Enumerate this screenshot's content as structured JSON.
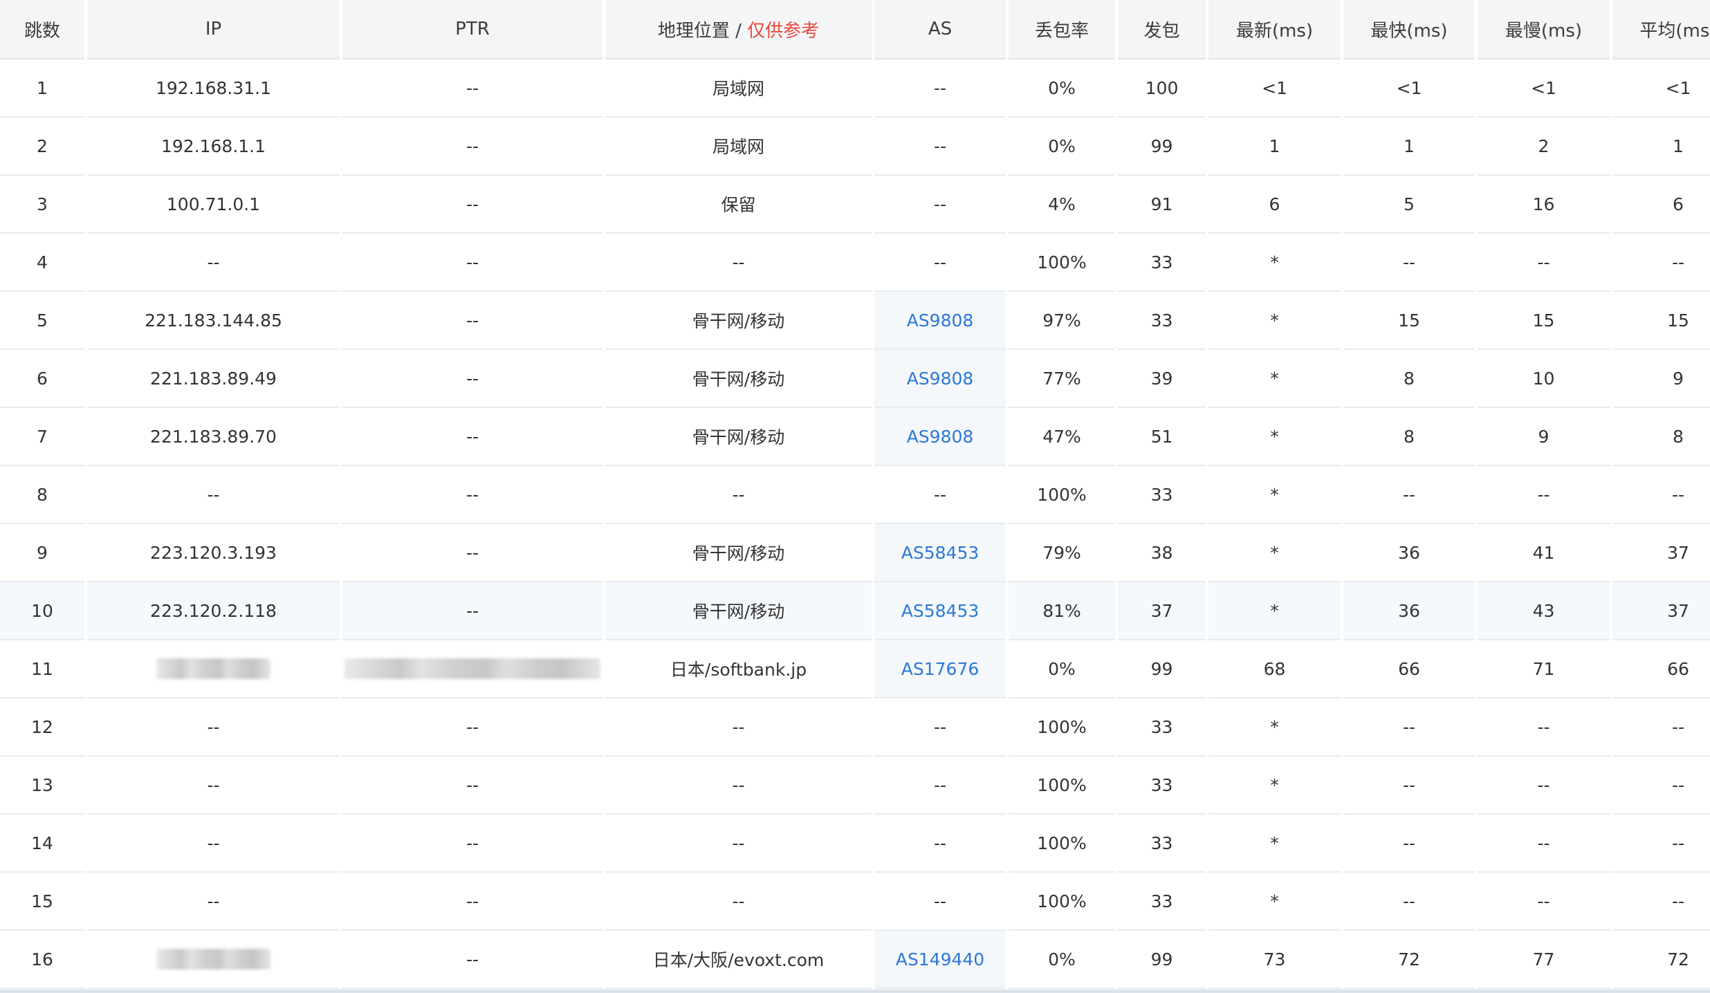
{
  "headers": {
    "hop": "跳数",
    "ip": "IP",
    "ptr": "PTR",
    "geo": "地理位置 / ",
    "geo_note": "仅供参考",
    "as": "AS",
    "loss": "丢包率",
    "sent": "发包",
    "last": "最新(ms)",
    "best": "最快(ms)",
    "worst": "最慢(ms)",
    "avg": "平均(ms)"
  },
  "rows": [
    {
      "hop": "1",
      "ip": "192.168.31.1",
      "ptr": "--",
      "geo": "局域网",
      "as": "--",
      "loss": "0%",
      "sent": "100",
      "last": "<1",
      "best": "<1",
      "worst": "<1",
      "avg": "<1"
    },
    {
      "hop": "2",
      "ip": "192.168.1.1",
      "ptr": "--",
      "geo": "局域网",
      "as": "--",
      "loss": "0%",
      "sent": "99",
      "last": "1",
      "best": "1",
      "worst": "2",
      "avg": "1"
    },
    {
      "hop": "3",
      "ip": "100.71.0.1",
      "ptr": "--",
      "geo": "保留",
      "as": "--",
      "loss": "4%",
      "sent": "91",
      "last": "6",
      "best": "5",
      "worst": "16",
      "avg": "6"
    },
    {
      "hop": "4",
      "ip": "--",
      "ptr": "--",
      "geo": "--",
      "as": "--",
      "loss": "100%",
      "sent": "33",
      "last": "*",
      "best": "--",
      "worst": "--",
      "avg": "--"
    },
    {
      "hop": "5",
      "ip": "221.183.144.85",
      "ptr": "--",
      "geo": "骨干网/移动",
      "as": "AS9808",
      "loss": "97%",
      "sent": "33",
      "last": "*",
      "best": "15",
      "worst": "15",
      "avg": "15"
    },
    {
      "hop": "6",
      "ip": "221.183.89.49",
      "ptr": "--",
      "geo": "骨干网/移动",
      "as": "AS9808",
      "loss": "77%",
      "sent": "39",
      "last": "*",
      "best": "8",
      "worst": "10",
      "avg": "9"
    },
    {
      "hop": "7",
      "ip": "221.183.89.70",
      "ptr": "--",
      "geo": "骨干网/移动",
      "as": "AS9808",
      "loss": "47%",
      "sent": "51",
      "last": "*",
      "best": "8",
      "worst": "9",
      "avg": "8"
    },
    {
      "hop": "8",
      "ip": "--",
      "ptr": "--",
      "geo": "--",
      "as": "--",
      "loss": "100%",
      "sent": "33",
      "last": "*",
      "best": "--",
      "worst": "--",
      "avg": "--"
    },
    {
      "hop": "9",
      "ip": "223.120.3.193",
      "ptr": "--",
      "geo": "骨干网/移动",
      "as": "AS58453",
      "loss": "79%",
      "sent": "38",
      "last": "*",
      "best": "36",
      "worst": "41",
      "avg": "37"
    },
    {
      "hop": "10",
      "ip": "223.120.2.118",
      "ptr": "--",
      "geo": "骨干网/移动",
      "as": "AS58453",
      "loss": "81%",
      "sent": "37",
      "last": "*",
      "best": "36",
      "worst": "43",
      "avg": "37"
    },
    {
      "hop": "11",
      "ip": "",
      "ptr": "",
      "geo": "日本/softbank.jp",
      "as": "AS17676",
      "loss": "0%",
      "sent": "99",
      "last": "68",
      "best": "66",
      "worst": "71",
      "avg": "66"
    },
    {
      "hop": "12",
      "ip": "--",
      "ptr": "--",
      "geo": "--",
      "as": "--",
      "loss": "100%",
      "sent": "33",
      "last": "*",
      "best": "--",
      "worst": "--",
      "avg": "--"
    },
    {
      "hop": "13",
      "ip": "--",
      "ptr": "--",
      "geo": "--",
      "as": "--",
      "loss": "100%",
      "sent": "33",
      "last": "*",
      "best": "--",
      "worst": "--",
      "avg": "--"
    },
    {
      "hop": "14",
      "ip": "--",
      "ptr": "--",
      "geo": "--",
      "as": "--",
      "loss": "100%",
      "sent": "33",
      "last": "*",
      "best": "--",
      "worst": "--",
      "avg": "--"
    },
    {
      "hop": "15",
      "ip": "--",
      "ptr": "--",
      "geo": "--",
      "as": "--",
      "loss": "100%",
      "sent": "33",
      "last": "*",
      "best": "--",
      "worst": "--",
      "avg": "--"
    },
    {
      "hop": "16",
      "ip": "",
      "ptr": "--",
      "geo": "日本/大阪/evoxt.com",
      "as": "AS149440",
      "loss": "0%",
      "sent": "99",
      "last": "73",
      "best": "72",
      "worst": "77",
      "avg": "72"
    }
  ],
  "colors": {
    "link": "#2c78d6",
    "warning": "#e8493f",
    "header_bg": "#f4f5f7",
    "highlight_row_bg": "#f5f8fc"
  }
}
